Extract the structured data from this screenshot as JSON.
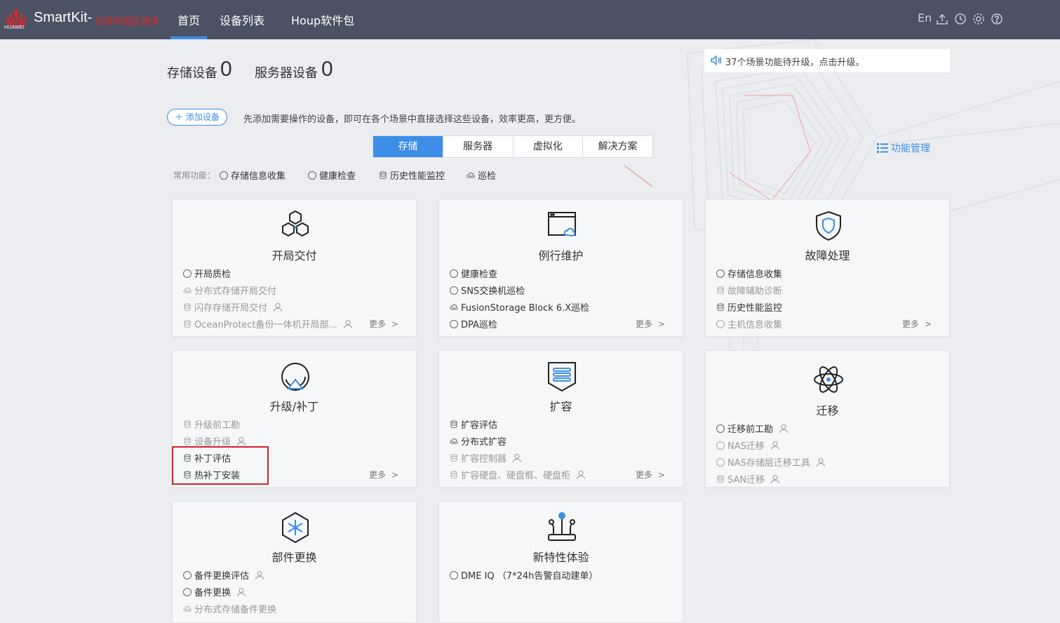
{
  "brand": {
    "logo_text": "HUAWEI",
    "name": "SmartKit-",
    "note": "仅限中国区使用"
  },
  "nav": [
    {
      "label": "首页",
      "active": true
    },
    {
      "label": "设备列表",
      "active": false
    },
    {
      "label": "Houp软件包",
      "active": false
    }
  ],
  "top_right": {
    "lang": "En",
    "icons": [
      "upload-icon",
      "clock-icon",
      "gear-icon",
      "help-icon"
    ]
  },
  "stats": {
    "storage_label": "存储设备",
    "storage_count": "0",
    "server_label": "服务器设备",
    "server_count": "0"
  },
  "notice": "37个场景功能待升级，点击升级。",
  "add_device": {
    "label": "＋ 添加设备",
    "hint": "先添加需要操作的设备，即可在各个场景中直接选择这些设备，效率更高，更方便。"
  },
  "tabs": [
    {
      "label": "存储",
      "active": true
    },
    {
      "label": "服务器",
      "active": false
    },
    {
      "label": "虚拟化",
      "active": false
    },
    {
      "label": "解决方案",
      "active": false
    }
  ],
  "func_mgmt": "功能管理",
  "common": {
    "label": "常用功能：",
    "items": [
      {
        "label": "存储信息收集",
        "icon": "circle"
      },
      {
        "label": "健康检查",
        "icon": "circle"
      },
      {
        "label": "历史性能监控",
        "icon": "db"
      },
      {
        "label": "巡检",
        "icon": "cloud"
      }
    ]
  },
  "more_label": "更多",
  "cards": [
    {
      "title": "开局交付",
      "icon": "hexagons-icon",
      "items": [
        {
          "label": "开局质检",
          "icon": "circle",
          "dim": false,
          "user": false
        },
        {
          "label": "分布式存储开局交付",
          "icon": "cloud",
          "dim": true,
          "user": false
        },
        {
          "label": "闪存存储开局交付",
          "icon": "db",
          "dim": true,
          "user": true
        },
        {
          "label": "OceanProtect备份一体机开局部...",
          "icon": "db",
          "dim": true,
          "user": true
        }
      ],
      "more": true
    },
    {
      "title": "例行维护",
      "icon": "window-cloud-icon",
      "items": [
        {
          "label": "健康检查",
          "icon": "circle",
          "dim": false,
          "user": false
        },
        {
          "label": "SNS交换机巡检",
          "icon": "circle",
          "dim": false,
          "user": false
        },
        {
          "label": "FusionStorage Block 6.X巡检",
          "icon": "cloud",
          "dim": false,
          "user": false
        },
        {
          "label": "DPA巡检",
          "icon": "circle",
          "dim": false,
          "user": false
        }
      ],
      "more": true
    },
    {
      "title": "故障处理",
      "icon": "shield-icon",
      "items": [
        {
          "label": "存储信息收集",
          "icon": "circle",
          "dim": false,
          "user": false
        },
        {
          "label": "故障辅助诊断",
          "icon": "db",
          "dim": true,
          "user": false
        },
        {
          "label": "历史性能监控",
          "icon": "db",
          "dim": false,
          "user": false
        },
        {
          "label": "主机信息收集",
          "icon": "circle",
          "dim": true,
          "user": false
        }
      ],
      "more": true
    },
    {
      "title": "升级/补丁",
      "icon": "upgrade-icon",
      "items": [
        {
          "label": "升级前工勘",
          "icon": "db",
          "dim": true,
          "user": false
        },
        {
          "label": "设备升级",
          "icon": "db",
          "dim": true,
          "user": true
        },
        {
          "label": "补丁评估",
          "icon": "db",
          "dim": false,
          "user": false
        },
        {
          "label": "热补丁安装",
          "icon": "db",
          "dim": false,
          "user": false
        }
      ],
      "more": true
    },
    {
      "title": "扩容",
      "icon": "expand-icon",
      "items": [
        {
          "label": "扩容评估",
          "icon": "db",
          "dim": false,
          "user": false
        },
        {
          "label": "分布式扩容",
          "icon": "cloud",
          "dim": false,
          "user": false
        },
        {
          "label": "扩容控制器",
          "icon": "db",
          "dim": true,
          "user": true
        },
        {
          "label": "扩容硬盘、硬盘框、硬盘柜",
          "icon": "db",
          "dim": true,
          "user": true
        }
      ],
      "more": true
    },
    {
      "title": "迁移",
      "icon": "atom-icon",
      "items": [
        {
          "label": "迁移前工勘",
          "icon": "circle",
          "dim": false,
          "user": true
        },
        {
          "label": "NAS迁移",
          "icon": "circle",
          "dim": true,
          "user": true
        },
        {
          "label": "NAS存储层迁移工具",
          "icon": "circle",
          "dim": true,
          "user": true
        },
        {
          "label": "SAN迁移",
          "icon": "db",
          "dim": true,
          "user": true
        }
      ],
      "more": false
    },
    {
      "title": "部件更换",
      "icon": "component-icon",
      "items": [
        {
          "label": "备件更换评估",
          "icon": "circle",
          "dim": false,
          "user": true
        },
        {
          "label": "备件更换",
          "icon": "circle",
          "dim": false,
          "user": true
        },
        {
          "label": "分布式存储备件更换",
          "icon": "cloud",
          "dim": true,
          "user": false
        }
      ],
      "more": false
    },
    {
      "title": "新特性体验",
      "icon": "feature-icon",
      "items": [
        {
          "label": "DME IQ （7*24h告警自动建单）",
          "icon": "circle",
          "dim": false,
          "user": false
        }
      ],
      "more": false
    }
  ]
}
